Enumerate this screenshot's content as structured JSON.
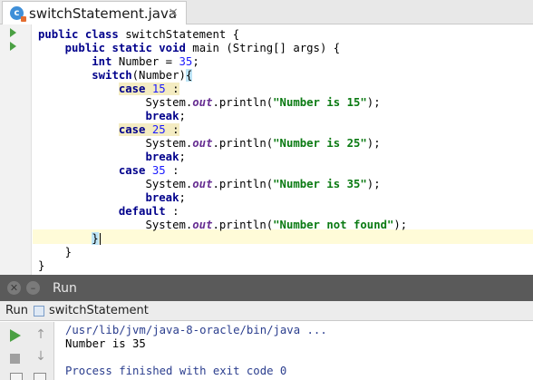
{
  "tab": {
    "icon_letter": "c",
    "title": "switchStatement.java",
    "close": "×"
  },
  "editor": {
    "lines": [
      [
        {
          "t": "public class ",
          "c": "kw"
        },
        {
          "t": "switchStatement {",
          "c": "plain"
        }
      ],
      [
        {
          "t": "    "
        },
        {
          "t": "public static void ",
          "c": "kw"
        },
        {
          "t": "main (String[] args) {",
          "c": "plain"
        }
      ],
      [
        {
          "t": "        "
        },
        {
          "t": "int ",
          "c": "kw"
        },
        {
          "t": "Number = ",
          "c": "plain"
        },
        {
          "t": "35",
          "c": "num"
        },
        {
          "t": ";",
          "c": "plain"
        }
      ],
      [
        {
          "t": "        "
        },
        {
          "t": "switch",
          "c": "kw"
        },
        {
          "t": "(Number)",
          "c": "plain"
        },
        {
          "t": "{",
          "c": "brace-hl"
        }
      ],
      [
        {
          "t": "            "
        },
        {
          "t": "case ",
          "c": "kw case-hl"
        },
        {
          "t": "15 ",
          "c": "num case-hl"
        },
        {
          "t": ":",
          "c": "plain case-hl"
        }
      ],
      [
        {
          "t": "                System.",
          "c": "plain"
        },
        {
          "t": "out",
          "c": "fld"
        },
        {
          "t": ".println(",
          "c": "plain"
        },
        {
          "t": "\"Number is 15\"",
          "c": "str"
        },
        {
          "t": ");",
          "c": "plain"
        }
      ],
      [
        {
          "t": "                "
        },
        {
          "t": "break",
          "c": "kw"
        },
        {
          "t": ";",
          "c": "plain"
        }
      ],
      [
        {
          "t": "            "
        },
        {
          "t": "case ",
          "c": "kw case-hl"
        },
        {
          "t": "25 ",
          "c": "num case-hl"
        },
        {
          "t": ":",
          "c": "plain case-hl"
        }
      ],
      [
        {
          "t": "                System.",
          "c": "plain"
        },
        {
          "t": "out",
          "c": "fld"
        },
        {
          "t": ".println(",
          "c": "plain"
        },
        {
          "t": "\"Number is 25\"",
          "c": "str"
        },
        {
          "t": ");",
          "c": "plain"
        }
      ],
      [
        {
          "t": "                "
        },
        {
          "t": "break",
          "c": "kw"
        },
        {
          "t": ";",
          "c": "plain"
        }
      ],
      [
        {
          "t": "            "
        },
        {
          "t": "case ",
          "c": "kw"
        },
        {
          "t": "35 ",
          "c": "num"
        },
        {
          "t": ":",
          "c": "plain"
        }
      ],
      [
        {
          "t": "                System.",
          "c": "plain"
        },
        {
          "t": "out",
          "c": "fld"
        },
        {
          "t": ".println(",
          "c": "plain"
        },
        {
          "t": "\"Number is 35\"",
          "c": "str"
        },
        {
          "t": ");",
          "c": "plain"
        }
      ],
      [
        {
          "t": "                "
        },
        {
          "t": "break",
          "c": "kw"
        },
        {
          "t": ";",
          "c": "plain"
        }
      ],
      [
        {
          "t": "            "
        },
        {
          "t": "default ",
          "c": "kw"
        },
        {
          "t": ":",
          "c": "plain"
        }
      ],
      [
        {
          "t": "                System.",
          "c": "plain"
        },
        {
          "t": "out",
          "c": "fld"
        },
        {
          "t": ".println(",
          "c": "plain"
        },
        {
          "t": "\"Number not found\"",
          "c": "str"
        },
        {
          "t": ");",
          "c": "plain"
        }
      ],
      [
        {
          "t": "        "
        },
        {
          "t": "}",
          "c": "brace-hl"
        },
        {
          "t": "",
          "c": "caret"
        }
      ],
      [
        {
          "t": "    }",
          "c": "plain"
        }
      ],
      [
        {
          "t": "}",
          "c": "plain"
        }
      ]
    ]
  },
  "run_panel": {
    "title": "Run",
    "tab_label": "Run",
    "config_name": "switchStatement",
    "console": [
      {
        "text": "/usr/lib/jvm/java-8-oracle/bin/java ...",
        "c": "cpath"
      },
      {
        "text": "Number is 35",
        "c": "cout"
      },
      {
        "text": "",
        "c": "cout"
      },
      {
        "text": "Process finished with exit code 0",
        "c": "cexit"
      }
    ]
  }
}
